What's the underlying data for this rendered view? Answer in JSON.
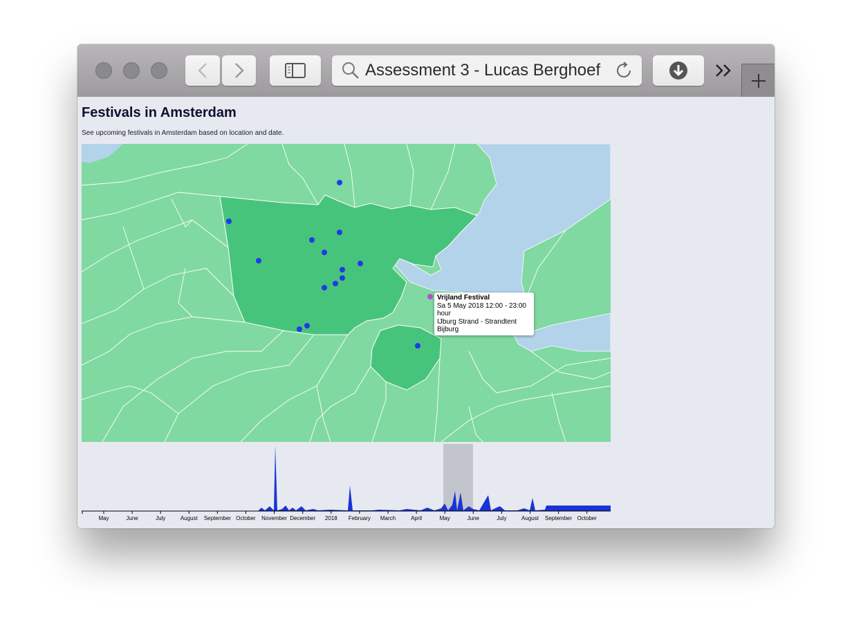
{
  "browser": {
    "address_text": "Assessment 3 - Lucas Berghoef",
    "back_icon": "chevron-left-icon",
    "forward_icon": "chevron-right-icon",
    "sidebar_icon": "sidebar-icon",
    "search_icon": "search-icon",
    "reload_icon": "reload-icon",
    "download_icon": "download-icon",
    "more_icon": "chevron-double-right-icon",
    "newtab_icon": "plus-icon"
  },
  "page": {
    "title": "Festivals in Amsterdam",
    "subtitle": "See upcoming festivals in Amsterdam based on location and date."
  },
  "colors": {
    "land": "#80d9a1",
    "amsterdam": "#47c47c",
    "water": "#b3d3ea",
    "festival_dot": "#1f3be6",
    "highlighted_dot": "#b054cc",
    "timeline_area": "#1a33d6",
    "brush": "#c3c5cc"
  },
  "tooltip": {
    "name": "Vrijland Festival",
    "date": "Sa 5 May 2018 12:00 - 23:00",
    "unit": "hour",
    "location": "IJburg Strand - Strandtent Bijburg"
  },
  "timeline": {
    "months": [
      "May",
      "June",
      "July",
      "August",
      "September",
      "October",
      "November",
      "December",
      "2018",
      "February",
      "March",
      "April",
      "May",
      "June",
      "July",
      "August",
      "September",
      "October"
    ]
  }
}
